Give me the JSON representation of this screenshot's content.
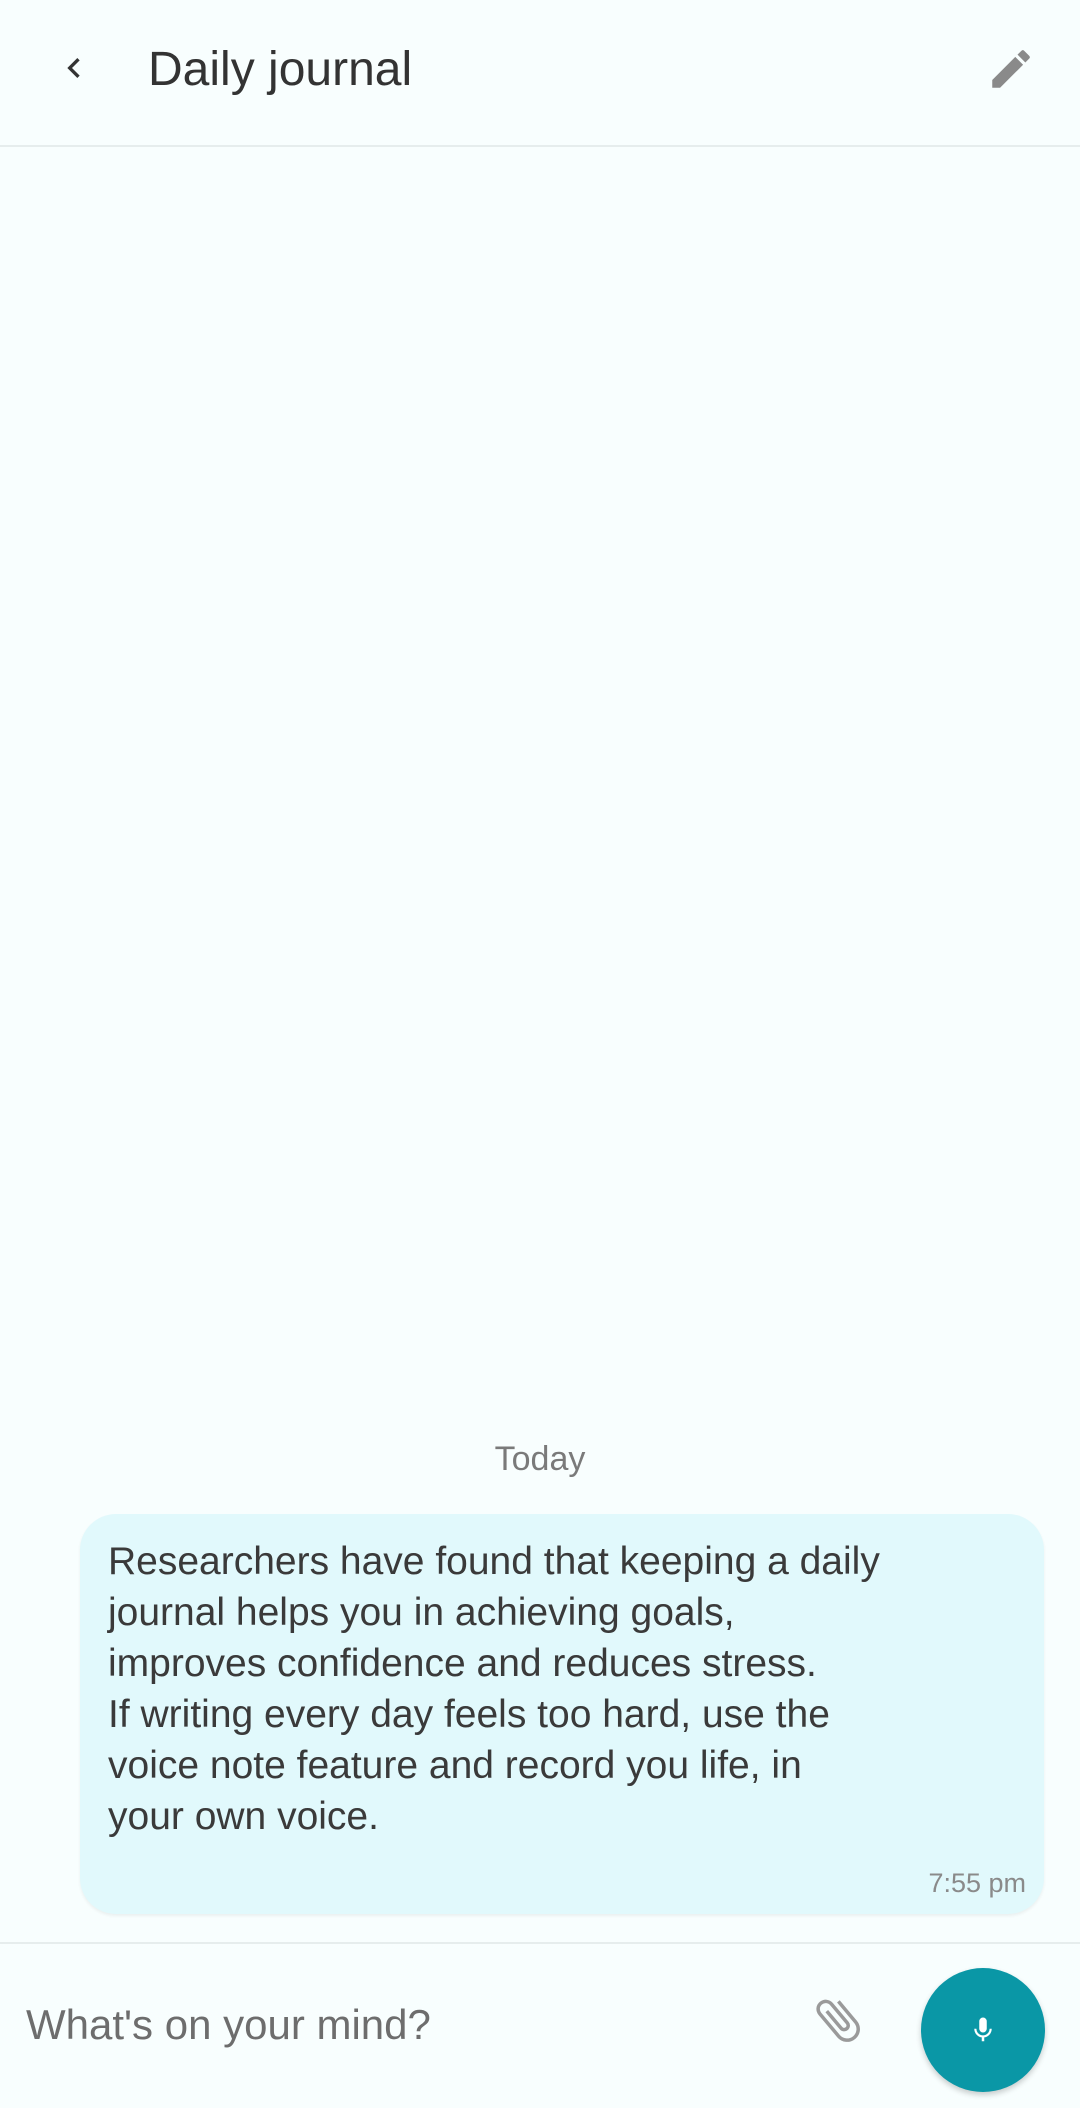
{
  "header": {
    "title": "Daily journal",
    "back_icon": "chevron-left-icon",
    "edit_icon": "pencil-icon"
  },
  "chat": {
    "date_separator": "Today",
    "messages": [
      {
        "text": "Researchers have found that keeping a daily journal helps you in achieving goals, improves confidence and reduces stress.\nIf writing every day feels too hard, use the voice note feature and record you life, in your own voice.",
        "time": "7:55 pm"
      }
    ]
  },
  "composer": {
    "placeholder": "What's on your mind?",
    "attach_icon": "paperclip-icon",
    "mic_icon": "microphone-icon"
  },
  "colors": {
    "background": "#f8fefe",
    "bubble": "#e1f9fc",
    "accent": "#0a97a6"
  }
}
